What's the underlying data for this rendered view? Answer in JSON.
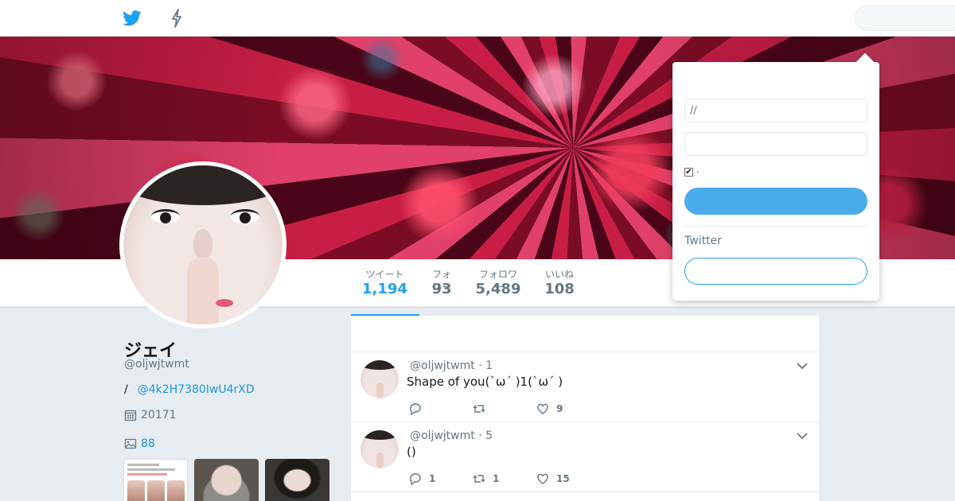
{
  "nav": {
    "search_placeholder": ""
  },
  "profile": {
    "name": "ジェイ",
    "handle": "@oljwjtwmt",
    "location_prefix": "/",
    "location_link": "@4k2H7380IwU4rXD",
    "joined": "20171",
    "media_count": "88"
  },
  "stats": [
    {
      "label": "ツイート",
      "value": "1,194"
    },
    {
      "label": "フォロー",
      "value": "93"
    },
    {
      "label": "フォロワー",
      "value": "5,489"
    },
    {
      "label": "いいね",
      "value": "108"
    }
  ],
  "tweets": [
    {
      "meta": "@oljwjtwmt · 1",
      "text": "Shape of you(`ω´ )1(`ω´ )",
      "replies": "",
      "retweets": "",
      "likes": "9"
    },
    {
      "meta": "@oljwjtwmt · 5",
      "text": "()",
      "replies": "1",
      "retweets": "1",
      "likes": "15"
    }
  ],
  "login": {
    "username_placeholder": "//",
    "password_placeholder": "",
    "remember_label": "·",
    "login_button": "",
    "new_label": "Twitter",
    "signup_button": ""
  },
  "colors": {
    "accent": "#1da1f2",
    "link": "#1b95e0",
    "background": "#e6ecf0"
  }
}
